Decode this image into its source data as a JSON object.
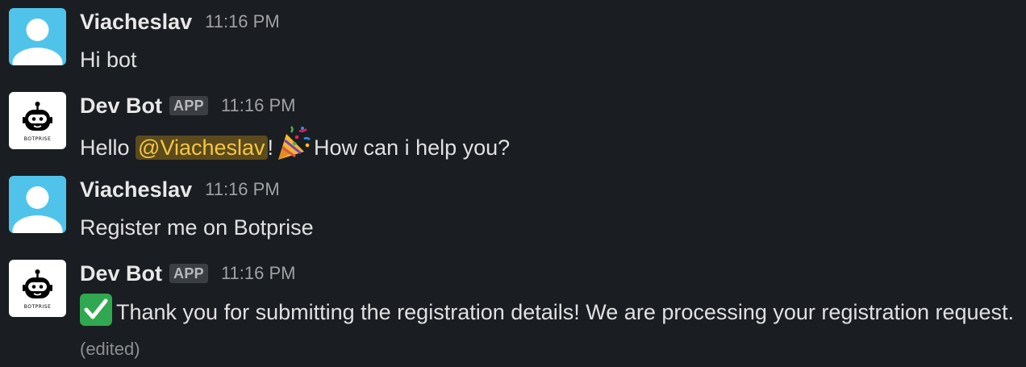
{
  "messages": [
    {
      "sender": "Viacheslav",
      "time": "11:16 PM",
      "text": "Hi bot"
    },
    {
      "sender": "Dev Bot",
      "badge": "APP",
      "time": "11:16 PM",
      "text_before": "Hello ",
      "mention": "@Viacheslav",
      "text_middle": "!",
      "text_after": "How can i help you?",
      "avatar_label": "BOTPRISE"
    },
    {
      "sender": "Viacheslav",
      "time": "11:16 PM",
      "text": "Register me on Botprise"
    },
    {
      "sender": "Dev Bot",
      "badge": "APP",
      "time": "11:16 PM",
      "text": "Thank you for submitting the registration details! We are processing your registration request.",
      "edited": "(edited)",
      "avatar_label": "BOTPRISE"
    }
  ],
  "icons": {
    "user_avatar": "person-silhouette-icon",
    "bot_avatar": "botprise-robot-icon",
    "party": "party-popper-icon",
    "check": "check-mark-button-icon"
  },
  "colors": {
    "background": "#1a1d21",
    "mention_bg": "#5c4a1d",
    "mention_text": "#f2c744",
    "check_green": "#2fa84f",
    "user_avatar": "#4fc3ea"
  }
}
